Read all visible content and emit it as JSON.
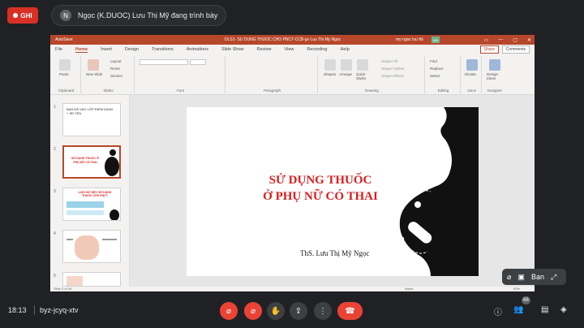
{
  "meeting": {
    "rec_label": "GHI",
    "presenter_initial": "N",
    "presenter_text": "Ngọc (K.DUOC) Lưu Thị Mỹ đang trình bày",
    "time": "18:13",
    "meeting_code": "byz-jcyq-xtv",
    "participant_count": "66",
    "you_label": "Bạn"
  },
  "ppt": {
    "autosave": "AutoSave",
    "doc_title": "DLS1- SU DUNG THUOC CHO PNCT-CCB-gv Luu Thi My Ngoc",
    "user_name": "my ngoc luu thi",
    "user_initials": "MN",
    "tabs": [
      "File",
      "Home",
      "Insert",
      "Design",
      "Transitions",
      "Animations",
      "Slide Show",
      "Review",
      "View",
      "Recording",
      "Help"
    ],
    "share": "Share",
    "comments": "Comments",
    "ribbon": {
      "paste": "Paste",
      "new_slide": "New Slide",
      "layout": "Layout",
      "reset": "Reset",
      "section": "Section",
      "shapes": "Shapes",
      "arrange": "Arrange",
      "quick_styles": "Quick Styles",
      "shape_fill": "Shape Fill",
      "shape_outline": "Shape Outline",
      "shape_effects": "Shape Effects",
      "find": "Find",
      "replace": "Replace",
      "select": "Select",
      "dictate": "Dictate",
      "design_ideas": "Design Ideas",
      "groups": [
        "Clipboard",
        "Slides",
        "Font",
        "Paragraph",
        "Drawing",
        "Editing",
        "Voice",
        "Designer"
      ]
    },
    "thumbnails": [
      {
        "num": "1",
        "text": "BẠN ĐÃ VÀO LỚP ĐIỂM DANH + SĐ TÊN"
      },
      {
        "num": "2",
        "text": "SỬ DỤNG THUỐC Ở PHỤ NỮ CÓ THAI"
      },
      {
        "num": "3",
        "text": "LỊCH SỬ VIỆC SỬ DỤNG THUỐC CHO PNCT"
      },
      {
        "num": "4",
        "text": ""
      },
      {
        "num": "5",
        "text": ""
      }
    ],
    "slide": {
      "title_line1": "SỬ DỤNG THUỐC",
      "title_line2": "Ở PHỤ NỮ CÓ THAI",
      "author": "ThS. Lưu Thị Mỹ Ngọc"
    },
    "status": {
      "slide_count": "Slide 2 of 49",
      "notes": "Notes",
      "zoom": "63%"
    }
  },
  "colors": {
    "ppt_accent": "#b7472a",
    "title_red": "#d81e1e",
    "meet_red": "#ea4335",
    "meet_bg": "#202124"
  }
}
